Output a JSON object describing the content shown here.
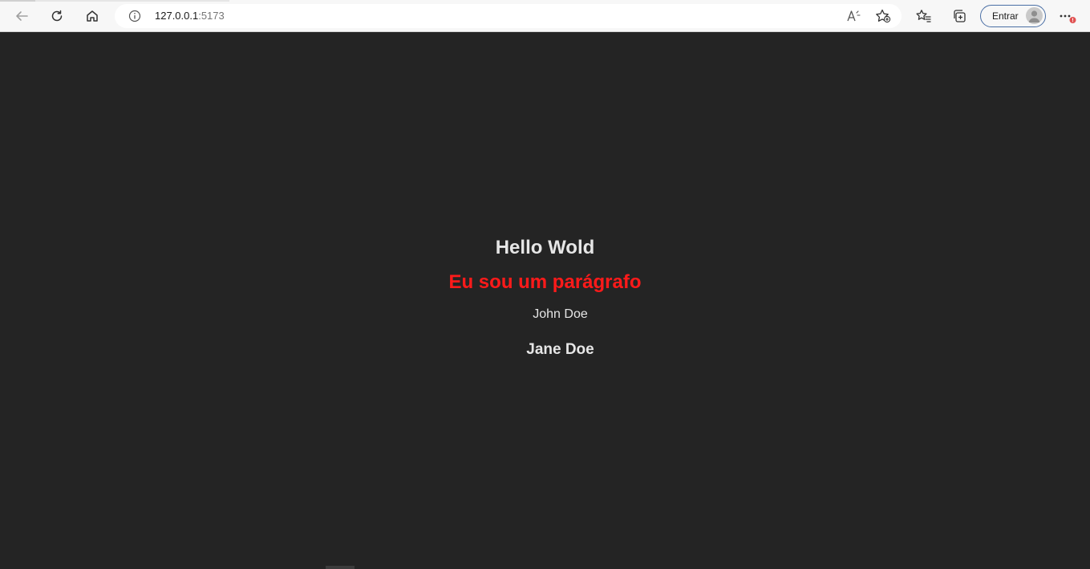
{
  "browser": {
    "url_host": "127.0.0.1",
    "url_port": ":5173",
    "signin_label": "Entrar",
    "icons": {
      "back": "back-arrow-icon",
      "refresh": "refresh-icon",
      "home": "home-icon",
      "site_info": "info-icon",
      "read_aloud": "read-aloud-icon",
      "add_favorite": "add-favorite-icon",
      "favorites": "favorites-icon",
      "collections": "collections-icon",
      "profile": "profile-avatar-icon",
      "more": "more-options-icon"
    },
    "accent_color": "#4a6fa5",
    "notification_color": "#e05252"
  },
  "page": {
    "background": "#242424",
    "title": "Hello Wold",
    "paragraph": "Eu sou um parágrafo",
    "paragraph_color": "#ff1a1a",
    "name_1": "John Doe",
    "name_2": "Jane Doe"
  }
}
